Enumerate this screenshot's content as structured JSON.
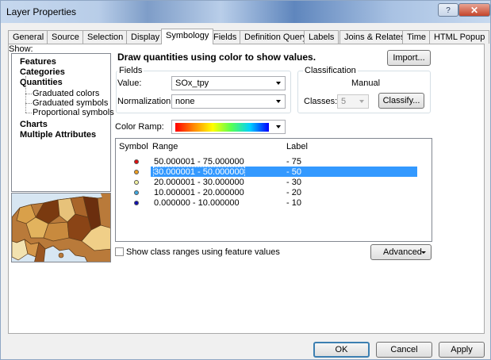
{
  "window": {
    "title": "Layer Properties",
    "help": "?",
    "close": "✕"
  },
  "tabs": [
    "General",
    "Source",
    "Selection",
    "Display",
    "Symbology",
    "Fields",
    "Definition Query",
    "Labels",
    "Joins & Relates",
    "Time",
    "HTML Popup"
  ],
  "active_tab": "Symbology",
  "show": {
    "label": "Show:",
    "items": {
      "features": "Features",
      "categories": "Categories",
      "quantities": "Quantities",
      "charts": "Charts",
      "multiple": "Multiple Attributes"
    },
    "sub_items": [
      "Graduated colors",
      "Graduated symbols",
      "Proportional symbols"
    ]
  },
  "heading": "Draw quantities using color to show values.",
  "import_button": "Import...",
  "fields": {
    "group_label": "Fields",
    "value_label": "Value:",
    "value": "SOx_tpy",
    "normalization_label": "Normalization:",
    "normalization": "none"
  },
  "classification": {
    "group_label": "Classification",
    "method": "Manual",
    "classes_label": "Classes:",
    "classes": "5",
    "classify_button": "Classify..."
  },
  "color_ramp": {
    "label": "Color Ramp:",
    "colors": [
      "#ff0000",
      "#ff8a00",
      "#ffff00",
      "#55ff55",
      "#00d0ff",
      "#0000ff"
    ]
  },
  "symbol_table": {
    "headers": {
      "symbol": "Symbol",
      "range": "Range",
      "label": "Label"
    },
    "rows": [
      {
        "range": "50.000001 - 75.000000",
        "label": "- 75",
        "color": "#e01010"
      },
      {
        "range": "30.000001 - 50.000000",
        "label": "- 50",
        "color": "#f0a020"
      },
      {
        "range": "20.000001 - 30.000000",
        "label": "- 30",
        "color": "#f2f2a0"
      },
      {
        "range": "10.000001 - 20.000000",
        "label": "- 20",
        "color": "#40a8e0"
      },
      {
        "range": "0.000000 - 10.000000",
        "label": "- 10",
        "color": "#1010b0"
      }
    ],
    "selected_index": 1
  },
  "show_class_ranges": "Show class ranges using feature values",
  "advanced_button": "Advanced",
  "buttons": {
    "ok": "OK",
    "cancel": "Cancel",
    "apply": "Apply"
  }
}
